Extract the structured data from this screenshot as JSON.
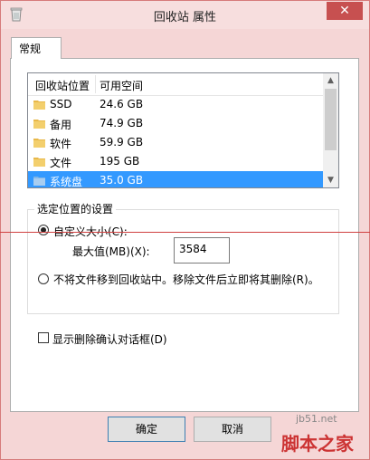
{
  "window": {
    "title": "回收站 属性",
    "close_glyph": "✕"
  },
  "tabs": [
    {
      "label": "常规"
    }
  ],
  "list": {
    "headers": {
      "location": "回收站位置",
      "space": "可用空间"
    },
    "rows": [
      {
        "name": "SSD",
        "size": "24.6 GB"
      },
      {
        "name": "备用",
        "size": "74.9 GB"
      },
      {
        "name": "软件",
        "size": "59.9 GB"
      },
      {
        "name": "文件",
        "size": "195 GB"
      },
      {
        "name": "系统盘",
        "size": "35.0 GB"
      }
    ],
    "selected_row": 4
  },
  "settings": {
    "legend": "选定位置的设置",
    "custom_size_label": "自定义大小(C):",
    "max_label": "最大值(MB)(X):",
    "max_value": "3584",
    "no_recycle_label": "不将文件移到回收站中。移除文件后立即将其删除(R)。",
    "selected_option": "custom_size"
  },
  "confirm_dialog": {
    "label": "显示删除确认对话框(D)",
    "checked": false
  },
  "buttons": {
    "ok": "确定",
    "cancel": "取消"
  },
  "watermark": {
    "url": "jb51.net",
    "name": "脚本之家"
  },
  "colors": {
    "titlebar": "#f7dede",
    "selection": "#3399ff",
    "close_button": "#c75050",
    "folder": "#e8b84a"
  }
}
